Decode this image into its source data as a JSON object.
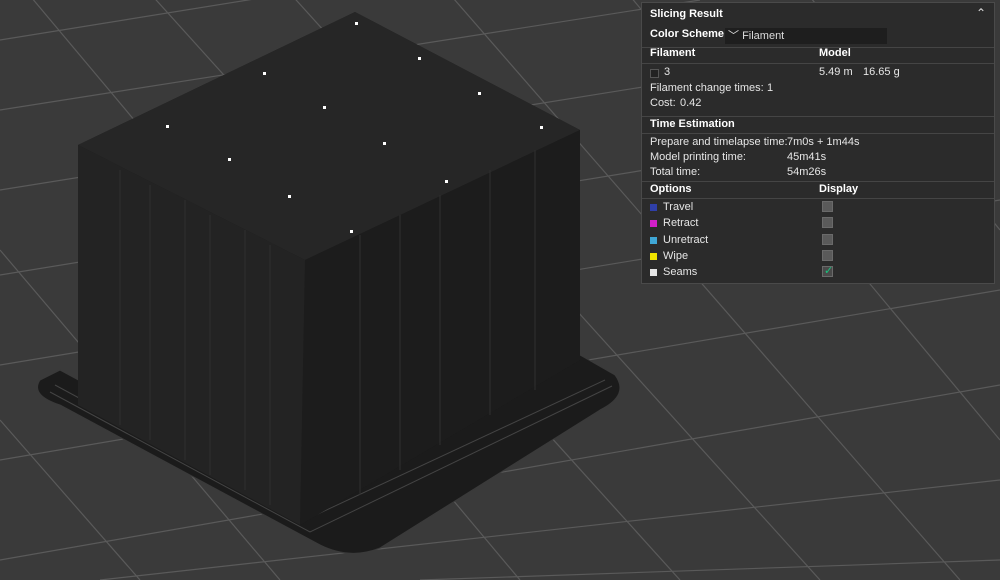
{
  "panel": {
    "title": "Slicing Result",
    "collapse_icon": "chevron-up-double",
    "color_scheme_label": "Color Scheme",
    "color_scheme_value": "Filament",
    "filament_header": "Filament",
    "model_header": "Model",
    "filament_id": "3",
    "filament_length": "5.49 m",
    "filament_weight": "16.65 g",
    "filament_change_label": "Filament change times:",
    "filament_change_value": "1",
    "cost_label": "Cost:",
    "cost_value": "0.42",
    "time_header": "Time Estimation",
    "prepare_label": "Prepare and timelapse time:",
    "prepare_value": "7m0s + 1m44s",
    "model_time_label": "Model printing time:",
    "model_time_value": "45m41s",
    "total_label": "Total time:",
    "total_value": "54m26s",
    "options_header": "Options",
    "display_header": "Display",
    "options": [
      {
        "label": "Travel",
        "color": "#2f3fa8",
        "checked": false
      },
      {
        "label": "Retract",
        "color": "#d11fc8",
        "checked": false
      },
      {
        "label": "Unretract",
        "color": "#3fa7d6",
        "checked": false
      },
      {
        "label": "Wipe",
        "color": "#f0e400",
        "checked": false
      },
      {
        "label": "Seams",
        "color": "#e6e6e6",
        "checked": true
      }
    ]
  },
  "colors": {
    "background": "#3a3a3a",
    "grid": "#5a5a5a",
    "model": "#1f1f1f",
    "panel_bg": "#2b2b2b"
  }
}
